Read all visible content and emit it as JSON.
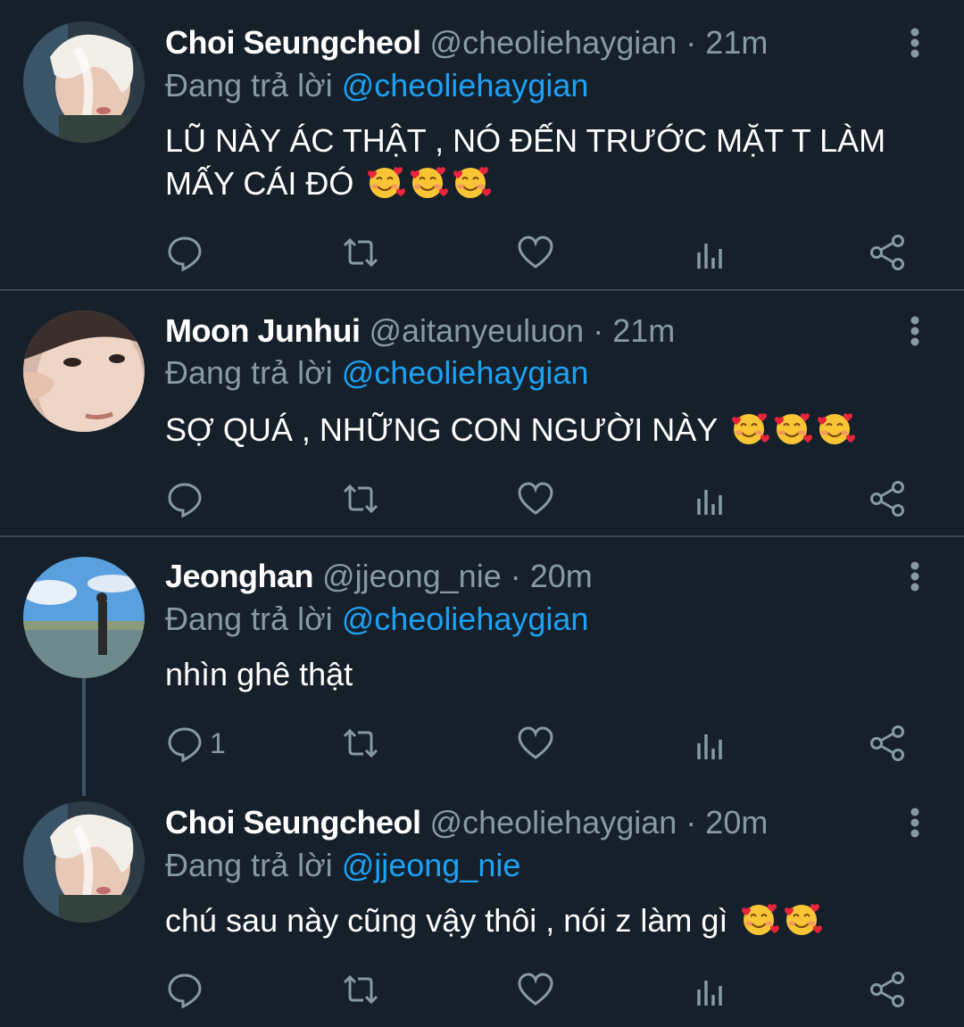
{
  "tweets": [
    {
      "name": "Choi Seungcheol",
      "handle": "@cheoliehaygian",
      "time": "21m",
      "reply_label": "Đang trả lời",
      "reply_to": "@cheoliehaygian",
      "text_lines": [
        "LŨ NÀY ÁC THẬT , NÓ ĐẾN TRƯỚC MẶT T LÀM",
        "MẤY CÁI ĐÓ"
      ],
      "emoji_count": 3,
      "reply_count": ""
    },
    {
      "name": "Moon Junhui",
      "handle": "@aitanyeuluon",
      "time": "21m",
      "reply_label": "Đang trả lời",
      "reply_to": "@cheoliehaygian",
      "text_lines": [
        "SỢ QUÁ , NHỮNG CON NGƯỜI NÀY"
      ],
      "emoji_count": 3,
      "reply_count": ""
    },
    {
      "name": "Jeonghan",
      "handle": "@jjeong_nie",
      "time": "20m",
      "reply_label": "Đang trả lời",
      "reply_to": "@cheoliehaygian",
      "text_lines": [
        "nhìn ghê thật"
      ],
      "emoji_count": 0,
      "reply_count": "1"
    },
    {
      "name": "Choi Seungcheol",
      "handle": "@cheoliehaygian",
      "time": "20m",
      "reply_label": "Đang trả lời",
      "reply_to": "@jjeong_nie",
      "text_lines": [
        "chú sau này cũng vậy thôi , nói z làm gì"
      ],
      "emoji_count": 2,
      "reply_count": ""
    }
  ],
  "separator": "·",
  "icons": {
    "reply": "reply-icon",
    "retweet": "retweet-icon",
    "like": "heart-icon",
    "analytics": "analytics-icon",
    "share": "share-icon",
    "more": "more-vertical-icon",
    "emoji": "smiling-face-with-hearts-emoji"
  },
  "colors": {
    "background": "#15202b",
    "divider": "#38444d",
    "muted": "#8899a6",
    "accent": "#1da1f2",
    "text": "#ffffff"
  }
}
